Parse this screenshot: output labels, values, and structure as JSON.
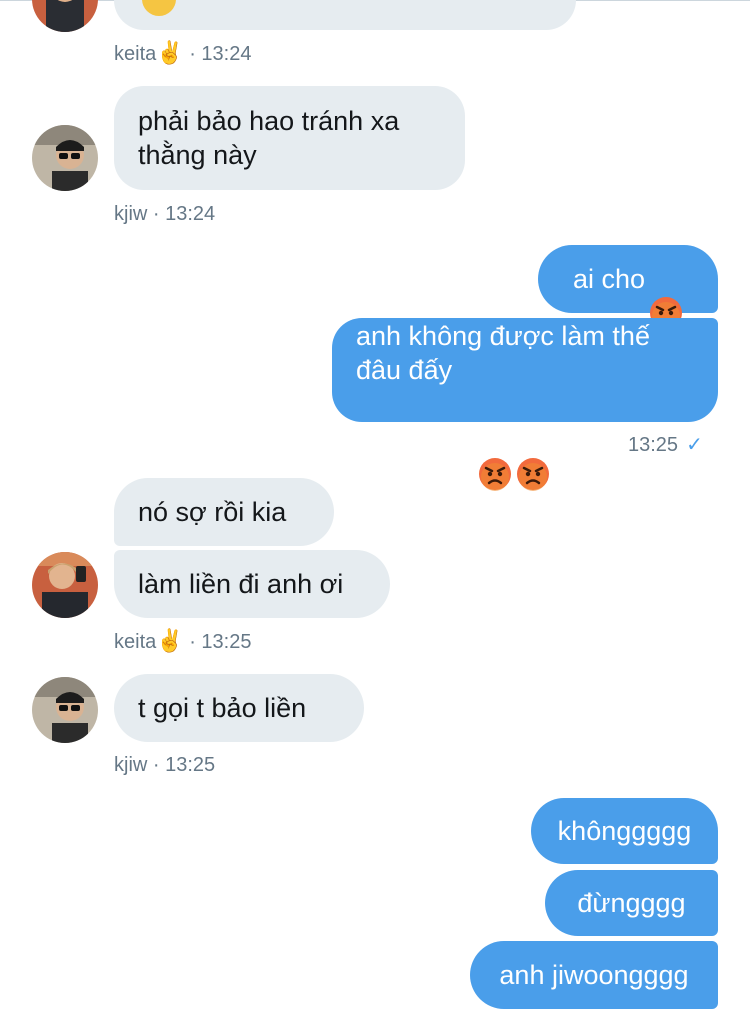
{
  "colors": {
    "incoming_bubble": "#e6ecf0",
    "outgoing_bubble": "#4a9eea",
    "meta_text": "#657786",
    "read_check": "#4a9eea"
  },
  "messages": [
    {
      "id": "m1",
      "sender": "keita",
      "time": "13:24",
      "meta": "keita",
      "meta_emoji": "✌️",
      "meta_time": " · 13:24"
    },
    {
      "id": "m2",
      "sender": "kjiw",
      "text": "phải bảo hao tránh xa\nthằng này",
      "meta": "kjiw · 13:24"
    },
    {
      "id": "m3",
      "sender": "me",
      "text": "ai cho"
    },
    {
      "id": "m4",
      "sender": "me",
      "text": "anh không được làm thế\nđâu đấy",
      "meta": "13:25",
      "read_icon": "check-icon"
    },
    {
      "id": "m5",
      "sender": "keita",
      "text": "nó sợ rồi kia"
    },
    {
      "id": "m6",
      "sender": "keita",
      "text": "làm liền đi anh ơi",
      "meta": "keita",
      "meta_emoji": "✌️",
      "meta_time": " · 13:25"
    },
    {
      "id": "m7",
      "sender": "kjiw",
      "text": "t gọi t bảo liền",
      "meta": "kjiw · 13:25"
    },
    {
      "id": "m8",
      "sender": "me",
      "text": "khônggggg"
    },
    {
      "id": "m9",
      "sender": "me",
      "text": "đừngggg"
    },
    {
      "id": "m10",
      "sender": "me",
      "text": "anh jiwoongggg"
    }
  ],
  "icons": {
    "angry_face": "angry-face-icon",
    "victory_hand": "victory-hand-icon",
    "check": "check-icon"
  }
}
